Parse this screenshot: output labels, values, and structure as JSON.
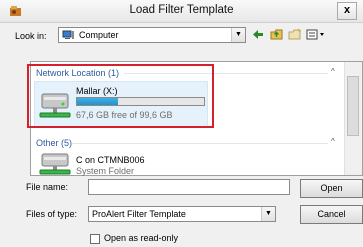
{
  "window": {
    "title": "Load Filter Template",
    "close_label": "x"
  },
  "toolbar": {
    "look_in_label": "Look in:",
    "look_in_value": "Computer",
    "dropdown_glyph": "▼",
    "icons": [
      "back-arrow-icon",
      "up-folder-icon",
      "new-folder-icon",
      "views-menu-icon"
    ]
  },
  "file_list": {
    "groups": [
      {
        "header": "Network Location (1)",
        "items": [
          {
            "name": "Mallar (X:)",
            "free_text": "67,6 GB free of 99,6 GB",
            "usage_fraction": 0.32,
            "icon": "network-drive-icon"
          }
        ]
      },
      {
        "header": "Other (5)",
        "items": [
          {
            "name": "C on CTMNB006",
            "type": "System Folder",
            "icon": "network-drive-icon"
          }
        ]
      }
    ],
    "chevron_up": "^"
  },
  "form": {
    "file_name_label": "File name:",
    "file_name_value": "",
    "files_of_type_label": "Files of type:",
    "files_of_type_value": "ProAlert Filter Template",
    "open_label": "Open",
    "cancel_label": "Cancel",
    "read_only_label": "Open as read-only",
    "read_only_checked": false
  },
  "colors": {
    "group_header": "#2c5aa0",
    "highlight_border": "#d3222d",
    "drive_bar": "#2691c4",
    "selection_bg": "#e5f1fb"
  }
}
